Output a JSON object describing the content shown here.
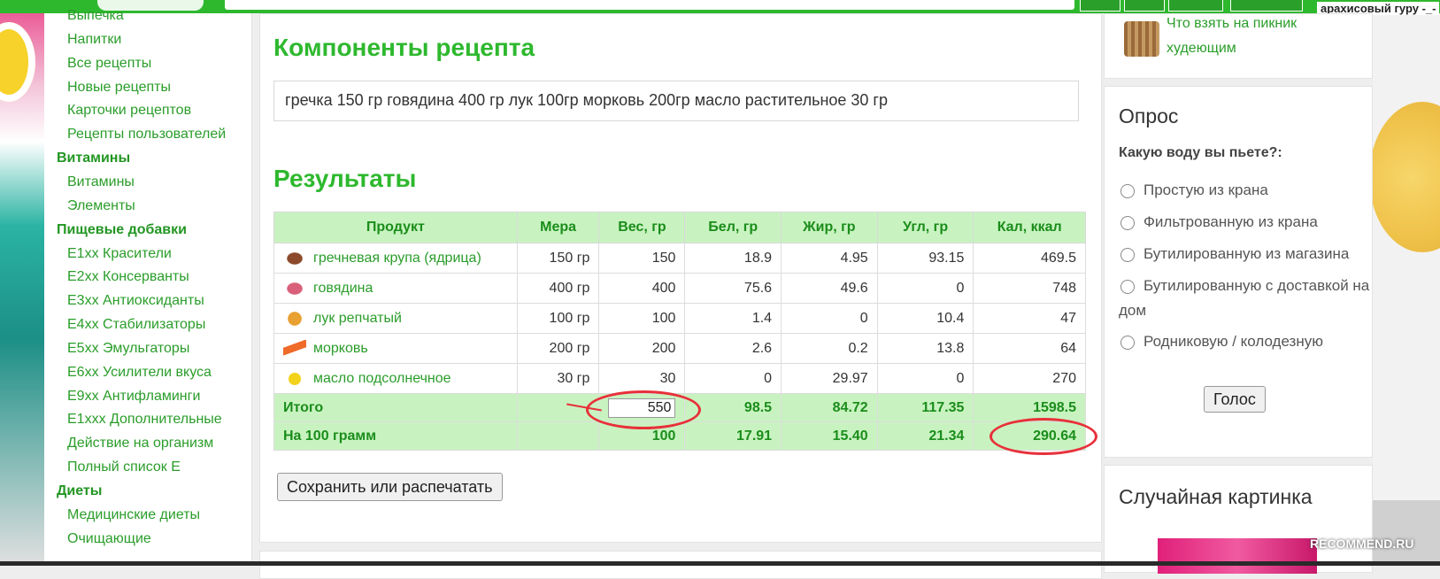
{
  "header": {
    "user_label": "арахисовый гуру -_-"
  },
  "sidebar": {
    "items": [
      {
        "label": "Выпечка",
        "type": "item"
      },
      {
        "label": "Напитки",
        "type": "item"
      },
      {
        "label": "Все рецепты",
        "type": "item"
      },
      {
        "label": "Новые рецепты",
        "type": "item"
      },
      {
        "label": "Карточки рецептов",
        "type": "item"
      },
      {
        "label": "Рецепты пользователей",
        "type": "item"
      },
      {
        "label": "Витамины",
        "type": "cat"
      },
      {
        "label": "Витамины",
        "type": "item"
      },
      {
        "label": "Элементы",
        "type": "item"
      },
      {
        "label": "Пищевые добавки",
        "type": "cat"
      },
      {
        "label": "E1xx Красители",
        "type": "item"
      },
      {
        "label": "E2xx Консерванты",
        "type": "item"
      },
      {
        "label": "E3xx Антиоксиданты",
        "type": "item"
      },
      {
        "label": "E4xx Стабилизаторы",
        "type": "item"
      },
      {
        "label": "E5xx Эмульгаторы",
        "type": "item"
      },
      {
        "label": "E6xx Усилители вкуса",
        "type": "item"
      },
      {
        "label": "E9xx Антифламинги",
        "type": "item"
      },
      {
        "label": "E1xxx Дополнительные",
        "type": "item"
      },
      {
        "label": "Действие на организм",
        "type": "item"
      },
      {
        "label": "Полный список Е",
        "type": "item"
      },
      {
        "label": "Диеты",
        "type": "cat"
      },
      {
        "label": "Медицинские диеты",
        "type": "item"
      },
      {
        "label": "Очищающие",
        "type": "item"
      }
    ]
  },
  "main": {
    "components_title": "Компоненты рецепта",
    "components_text": "гречка 150 гр говядина 400 гр лук 100гр морковь 200гр масло растительное 30 гр",
    "results_title": "Результаты",
    "table": {
      "headers": [
        "Продукт",
        "Мера",
        "Вес, гр",
        "Бел, гр",
        "Жир, гр",
        "Угл, гр",
        "Кал, ккал"
      ],
      "rows": [
        {
          "product": "гречневая крупа (ядрица)",
          "icon": "buckwheat-icon",
          "measure": "150 гр",
          "weight": "150",
          "protein": "18.9",
          "fat": "4.95",
          "carbs": "93.15",
          "kcal": "469.5"
        },
        {
          "product": "говядина",
          "icon": "beef-icon",
          "measure": "400 гр",
          "weight": "400",
          "protein": "75.6",
          "fat": "49.6",
          "carbs": "0",
          "kcal": "748"
        },
        {
          "product": "лук репчатый",
          "icon": "onion-icon",
          "measure": "100 гр",
          "weight": "100",
          "protein": "1.4",
          "fat": "0",
          "carbs": "10.4",
          "kcal": "47"
        },
        {
          "product": "морковь",
          "icon": "carrot-icon",
          "measure": "200 гр",
          "weight": "200",
          "protein": "2.6",
          "fat": "0.2",
          "carbs": "13.8",
          "kcal": "64"
        },
        {
          "product": "масло подсолнечное",
          "icon": "sunflower-oil-icon",
          "measure": "30 гр",
          "weight": "30",
          "protein": "0",
          "fat": "29.97",
          "carbs": "0",
          "kcal": "270"
        }
      ],
      "total": {
        "label": "Итого",
        "weight": "550",
        "protein": "98.5",
        "fat": "84.72",
        "carbs": "117.35",
        "kcal": "1598.5"
      },
      "per100": {
        "label": "На 100 грамм",
        "weight": "100",
        "protein": "17.91",
        "fat": "15.40",
        "carbs": "21.34",
        "kcal": "290.64"
      }
    },
    "save_button": "Сохранить или распечатать"
  },
  "right": {
    "picnic_link": "Что взять на пикник худеющим",
    "poll": {
      "title": "Опрос",
      "question": "Какую воду вы пьете?:",
      "options": [
        "Простую из крана",
        "Фильтрованную из крана",
        "Бутилированную из магазина",
        "Бутилированную с доставкой на дом",
        "Родниковую / колодезную"
      ],
      "vote_button": "Голос"
    },
    "random_title": "Случайная картинка"
  },
  "watermark": "RECOMMEND.RU",
  "colors": {
    "accent_green": "#2eb82e",
    "table_header_bg": "#c8f3c0",
    "annotation_red": "#e8303a"
  }
}
